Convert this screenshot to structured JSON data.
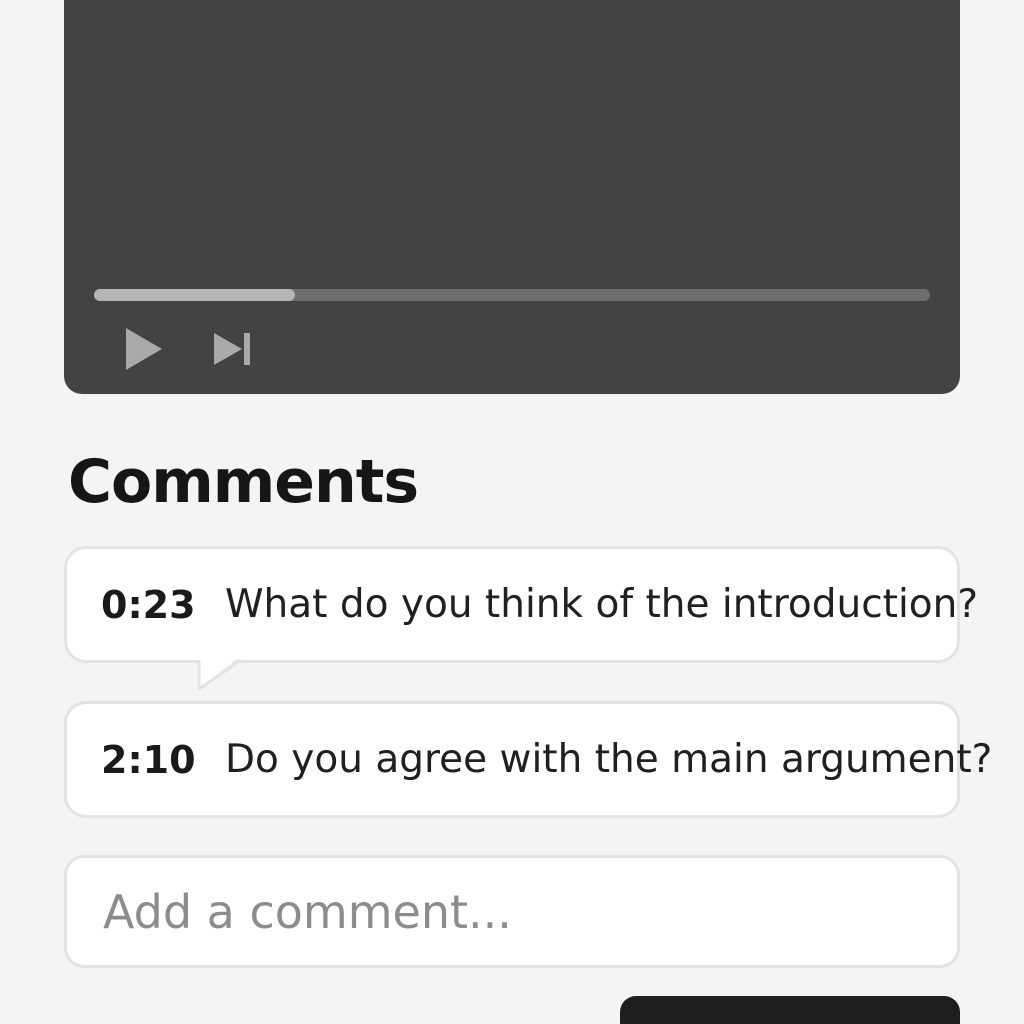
{
  "player": {
    "progress_percent": 24,
    "controls": {
      "play_icon": "play-icon",
      "next_icon": "skip-next-icon"
    }
  },
  "comments_section": {
    "title": "Comments",
    "items": [
      {
        "timestamp": "0:23",
        "text": "What do you think of the introduction?"
      },
      {
        "timestamp": "2:10",
        "text": "Do you agree with the main argument?"
      }
    ]
  },
  "comment_input": {
    "value": "",
    "placeholder": "Add a comment..."
  },
  "colors": {
    "player_background": "#434343",
    "progress_fill": "#b5b5b5",
    "progress_track": "#6e6e6e",
    "page_background": "#f4f4f4",
    "card_border": "#e3e3e3",
    "button_background": "#1e1e1e"
  }
}
